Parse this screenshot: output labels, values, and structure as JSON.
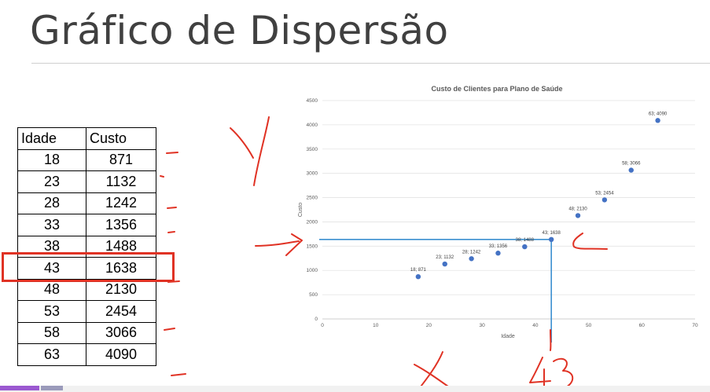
{
  "slide": {
    "title": "Gráfico de Dispersão"
  },
  "table": {
    "headers": [
      "Idade",
      "Custo"
    ],
    "rows": [
      [
        "18",
        "871"
      ],
      [
        "23",
        "1132"
      ],
      [
        "28",
        "1242"
      ],
      [
        "33",
        "1356"
      ],
      [
        "38",
        "1488"
      ],
      [
        "43",
        "1638"
      ],
      [
        "48",
        "2130"
      ],
      [
        "53",
        "2454"
      ],
      [
        "58",
        "3066"
      ],
      [
        "63",
        "4090"
      ]
    ],
    "highlighted_row": 5
  },
  "chart_data": {
    "type": "scatter",
    "title": "Custo de Clientes para Plano de Saúde",
    "xlabel": "Idade",
    "ylabel": "Custo",
    "xlim": [
      0,
      70
    ],
    "ylim": [
      0,
      4500
    ],
    "xticks": [
      "0",
      "10",
      "20",
      "30",
      "40",
      "50",
      "60",
      "70"
    ],
    "yticks": [
      "0",
      "500",
      "1000",
      "1500",
      "2000",
      "2500",
      "3000",
      "3500",
      "4000",
      "4500"
    ],
    "points": [
      {
        "x": 18,
        "y": 871,
        "label": "18; 871"
      },
      {
        "x": 23,
        "y": 1132,
        "label": "23; 1132"
      },
      {
        "x": 28,
        "y": 1242,
        "label": "28; 1242"
      },
      {
        "x": 33,
        "y": 1356,
        "label": "33; 1356"
      },
      {
        "x": 38,
        "y": 1488,
        "label": "38; 1488"
      },
      {
        "x": 43,
        "y": 1638,
        "label": "43; 1638"
      },
      {
        "x": 48,
        "y": 2130,
        "label": "48; 2130"
      },
      {
        "x": 53,
        "y": 2454,
        "label": "53; 2454"
      },
      {
        "x": 58,
        "y": 3066,
        "label": "58; 3066"
      },
      {
        "x": 63,
        "y": 4090,
        "label": "63; 4090"
      }
    ],
    "grid": true,
    "marker_color": "#4472c4",
    "guide_lines": {
      "x": 43,
      "y": 1638,
      "color": "#3b8fd0"
    }
  },
  "annotations": {
    "ink_color": "#e03224",
    "x_letter": "X",
    "y_letter": "Y",
    "x_value": "43"
  }
}
